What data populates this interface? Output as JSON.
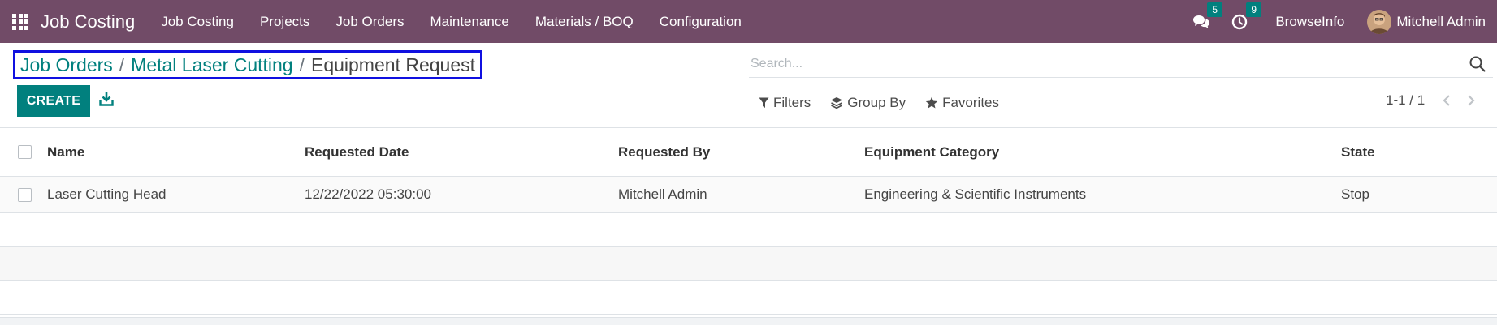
{
  "navbar": {
    "brand": "Job Costing",
    "menu": [
      "Job Costing",
      "Projects",
      "Job Orders",
      "Maintenance",
      "Materials / BOQ",
      "Configuration"
    ],
    "messages_count": "5",
    "activities_count": "9",
    "company": "BrowseInfo",
    "user": "Mitchell Admin",
    "bg_color": "#714b67"
  },
  "breadcrumb": {
    "items": [
      "Job Orders",
      "Metal Laser Cutting"
    ],
    "separator": "/",
    "active": "Equipment Request"
  },
  "search": {
    "placeholder": "Search..."
  },
  "toolbar": {
    "create_label": "CREATE"
  },
  "filters": {
    "filters_label": "Filters",
    "group_by_label": "Group By",
    "favorites_label": "Favorites"
  },
  "pager": {
    "value": "1-1 / 1"
  },
  "table": {
    "columns": [
      "Name",
      "Requested Date",
      "Requested By",
      "Equipment Category",
      "State"
    ],
    "rows": [
      [
        "Laser Cutting Head",
        "12/22/2022 05:30:00",
        "Mitchell Admin",
        "Engineering & Scientific Instruments",
        "Stop"
      ]
    ]
  },
  "accent_color": "#01807e"
}
